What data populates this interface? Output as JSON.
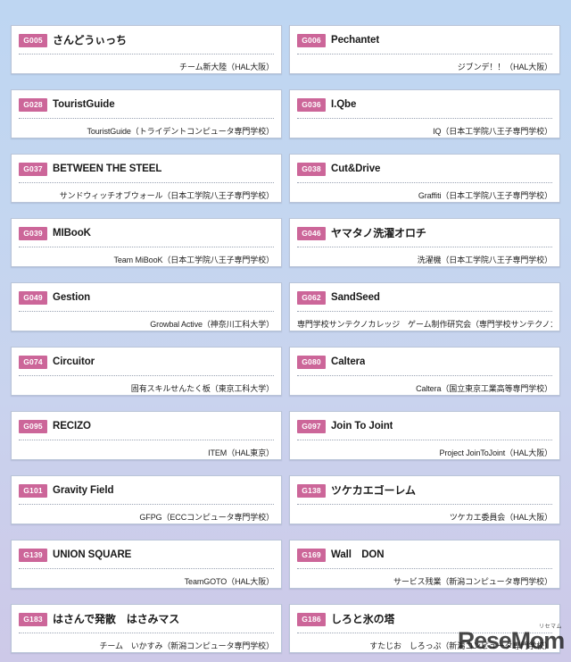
{
  "page": {
    "background_top_color": "#bed6f2",
    "background_bottom_color": "#cdc9e8",
    "badge_color": "#cc6699",
    "card_background": "#ffffff"
  },
  "watermark": {
    "text": "ReseMom",
    "ruby": "リセマム"
  },
  "entries": [
    {
      "id": "G005",
      "title": "さんどうぃっち",
      "jp": true,
      "team": "チーム新大陸（HAL大阪）"
    },
    {
      "id": "G006",
      "title": "Pechantet",
      "jp": false,
      "team": "ジブンデ！！（HAL大阪）"
    },
    {
      "id": "G028",
      "title": "TouristGuide",
      "jp": false,
      "team": "TouristGuide（トライデントコンピュータ専門学校）"
    },
    {
      "id": "G036",
      "title": "I.Qbe",
      "jp": false,
      "team": "IQ（日本工学院八王子専門学校）"
    },
    {
      "id": "G037",
      "title": "BETWEEN THE STEEL",
      "jp": false,
      "team": "サンドウィッチオブウォール（日本工学院八王子専門学校）"
    },
    {
      "id": "G038",
      "title": "Cut&Drive",
      "jp": false,
      "team": "Graffiti（日本工学院八王子専門学校）"
    },
    {
      "id": "G039",
      "title": "MIBooK",
      "jp": false,
      "team": "Team MiBooK（日本工学院八王子専門学校）"
    },
    {
      "id": "G046",
      "title": "ヤマタノ洗濯オロチ",
      "jp": true,
      "team": "洗濯機（日本工学院八王子専門学校）"
    },
    {
      "id": "G049",
      "title": "Gestion",
      "jp": false,
      "team": "Growbal Active（神奈川工科大学）"
    },
    {
      "id": "G062",
      "title": "SandSeed",
      "jp": false,
      "team": "専門学校サンテクノカレッジ　ゲーム制作研究会（専門学校サンテクノカレッジ）"
    },
    {
      "id": "G074",
      "title": "Circuitor",
      "jp": false,
      "team": "固有スキルせんたく板（東京工科大学）"
    },
    {
      "id": "G080",
      "title": "Caltera",
      "jp": false,
      "team": "Caltera（国立東京工業高等専門学校）"
    },
    {
      "id": "G095",
      "title": "RECIZO",
      "jp": false,
      "team": "ITEM（HAL東京）"
    },
    {
      "id": "G097",
      "title": "Join To Joint",
      "jp": false,
      "team": "Project JoinToJoint（HAL大阪）"
    },
    {
      "id": "G101",
      "title": "Gravity Field",
      "jp": false,
      "team": "GFPG（ECCコンピュータ専門学校）"
    },
    {
      "id": "G138",
      "title": "ツケカエゴーレム",
      "jp": true,
      "team": "ツケカエ委員会（HAL大阪）"
    },
    {
      "id": "G139",
      "title": "UNION SQUARE",
      "jp": false,
      "team": "TeamGOTO（HAL大阪）"
    },
    {
      "id": "G169",
      "title": "Wall　DON",
      "jp": false,
      "team": "サービス残業（新潟コンピュータ専門学校）"
    },
    {
      "id": "G183",
      "title": "はさんで発散　はさみマス",
      "jp": true,
      "team": "チーム　いかすみ（新潟コンピュータ専門学校）"
    },
    {
      "id": "G186",
      "title": "しろと氷の塔",
      "jp": true,
      "team": "すたじお　しろっぷ（新潟コンピュータ専門学校）"
    }
  ]
}
